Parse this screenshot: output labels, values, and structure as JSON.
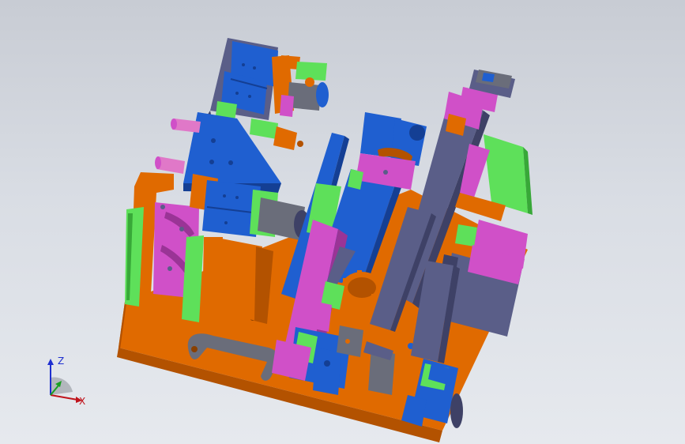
{
  "view": {
    "background_top": "#c8ccd4",
    "background_bottom": "#e6e9ee"
  },
  "triad": {
    "z_label": "Z",
    "x_label": "X",
    "z_color": "#1f2fd0",
    "x_color": "#c0141c",
    "y_color": "#18a020"
  },
  "model": {
    "name": "fixture-assembly",
    "colors": {
      "base": "#e06a00",
      "base_dark": "#b35200",
      "blue": "#1f5fd0",
      "blue_dark": "#143f94",
      "magenta": "#d050c8",
      "magenta_dark": "#9a3496",
      "green": "#5ee05a",
      "green_dark": "#38a838",
      "slate": "#5a5e88",
      "slate_dark": "#3e4166",
      "grey": "#6a6d7a",
      "pink": "#e078c8"
    }
  }
}
